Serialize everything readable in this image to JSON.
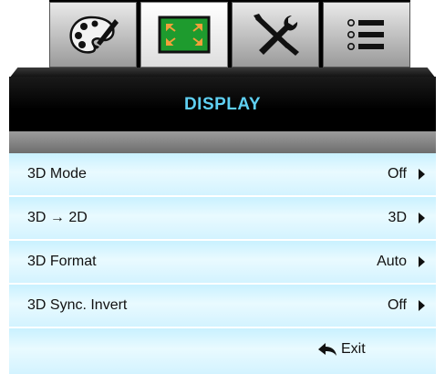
{
  "tabs": [
    {
      "name": "picture-tab",
      "icon": "palette-icon"
    },
    {
      "name": "display-tab",
      "icon": "display-resize-icon",
      "active": true
    },
    {
      "name": "setup-tab",
      "icon": "tools-icon"
    },
    {
      "name": "options-tab",
      "icon": "menu-list-icon"
    }
  ],
  "header": {
    "title": "DISPLAY"
  },
  "menu": {
    "items": [
      {
        "label": "3D Mode",
        "value": "Off"
      },
      {
        "label": "3D → 2D",
        "value": "3D"
      },
      {
        "label": "3D Format",
        "value": "Auto"
      },
      {
        "label": "3D Sync. Invert",
        "value": "Off"
      }
    ],
    "exit_label": "Exit"
  },
  "colors": {
    "title": "#5fd0f3",
    "row_background": "#d3f3ff",
    "active_tab_icon": "#1e9b2e"
  }
}
